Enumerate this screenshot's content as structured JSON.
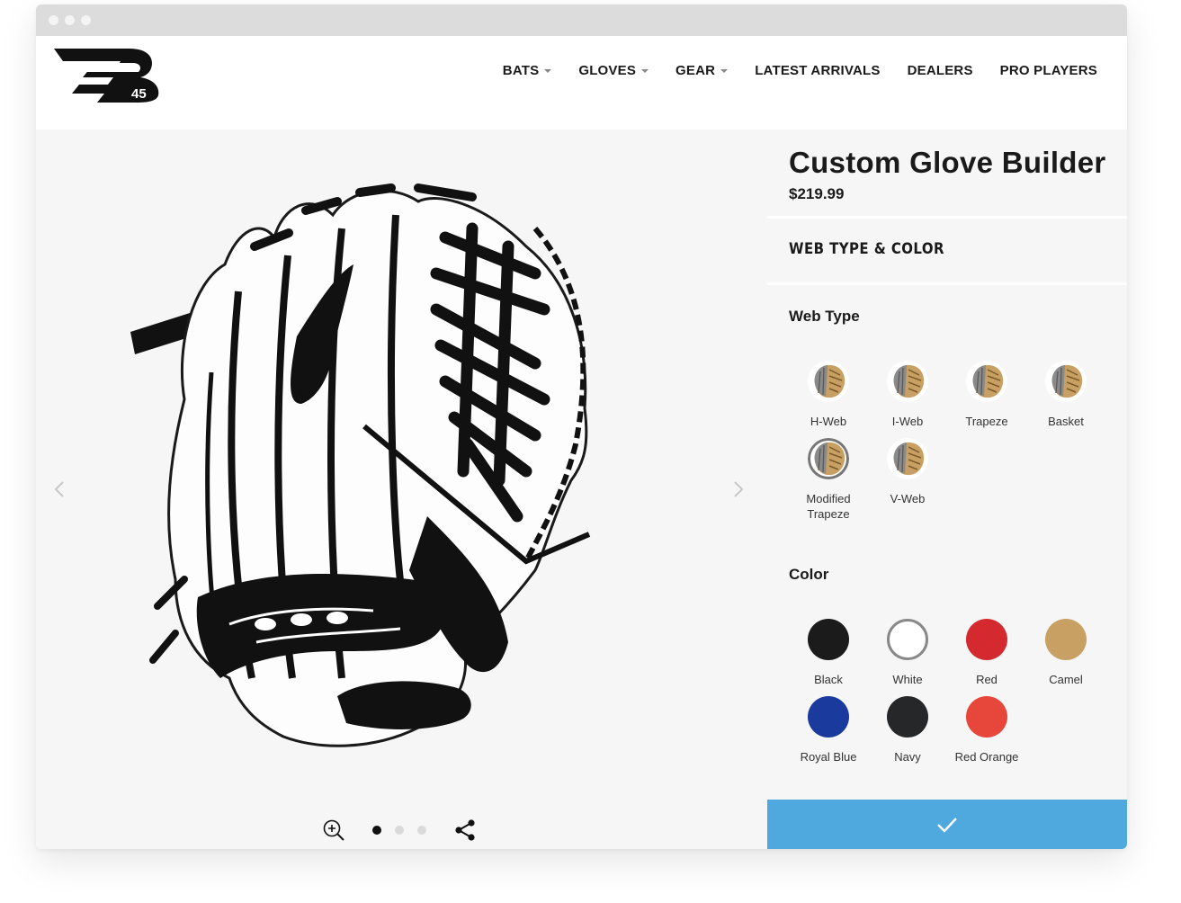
{
  "nav": {
    "items": [
      {
        "label": "BATS",
        "dropdown": true
      },
      {
        "label": "GLOVES",
        "dropdown": true
      },
      {
        "label": "GEAR",
        "dropdown": true
      },
      {
        "label": "LATEST ARRIVALS",
        "dropdown": false
      },
      {
        "label": "DEALERS",
        "dropdown": false
      },
      {
        "label": "PRO PLAYERS",
        "dropdown": false
      }
    ]
  },
  "logo": {
    "text": "45"
  },
  "product": {
    "title": "Custom Glove Builder",
    "price": "$219.99",
    "section": "WEB TYPE & COLOR"
  },
  "web_type": {
    "label": "Web Type",
    "options": [
      {
        "label": "H-Web"
      },
      {
        "label": "I-Web"
      },
      {
        "label": "Trapeze"
      },
      {
        "label": "Basket"
      },
      {
        "label": "Modified\nTrapeze",
        "selected": true
      },
      {
        "label": "V-Web"
      }
    ]
  },
  "color": {
    "label": "Color",
    "options": [
      {
        "label": "Black",
        "hex": "#1b1b1b"
      },
      {
        "label": "White",
        "hex": "#ffffff",
        "selected": true
      },
      {
        "label": "Red",
        "hex": "#d42a2f"
      },
      {
        "label": "Camel",
        "hex": "#c8a064"
      },
      {
        "label": "Royal Blue",
        "hex": "#1b3a9e"
      },
      {
        "label": "Navy",
        "hex": "#262729"
      },
      {
        "label": "Red Orange",
        "hex": "#e6473a"
      }
    ]
  },
  "viewer": {
    "slide_count": 3,
    "active_slide": 1
  },
  "colors": {
    "accent": "#4fa9df",
    "panel_bg": "#f6f6f6"
  }
}
